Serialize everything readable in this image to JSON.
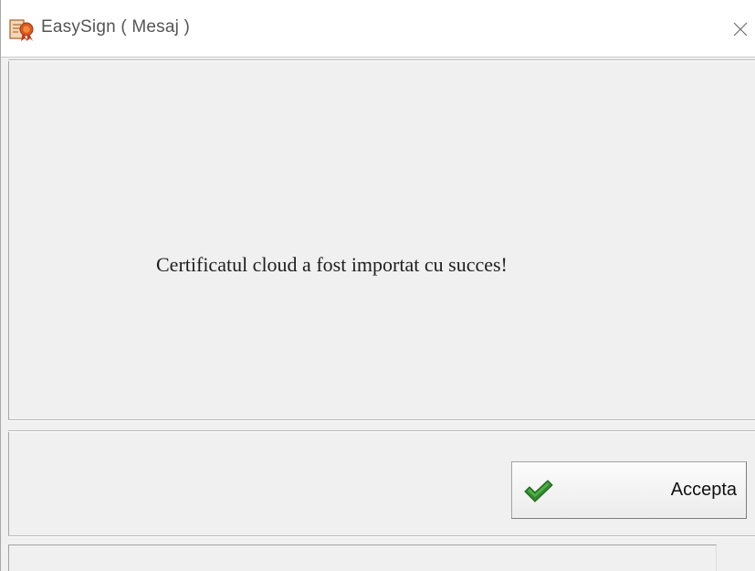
{
  "window": {
    "title": "EasySign ( Mesaj )",
    "app_icon": "certificate-icon",
    "close_icon": "close-icon"
  },
  "message": {
    "text": "Certificatul cloud a fost importat cu succes!"
  },
  "actions": {
    "accept_label": "Accepta",
    "accept_icon": "checkmark-icon",
    "accept_icon_color": "#2e8b2e"
  },
  "status_bar": {
    "text": ""
  }
}
